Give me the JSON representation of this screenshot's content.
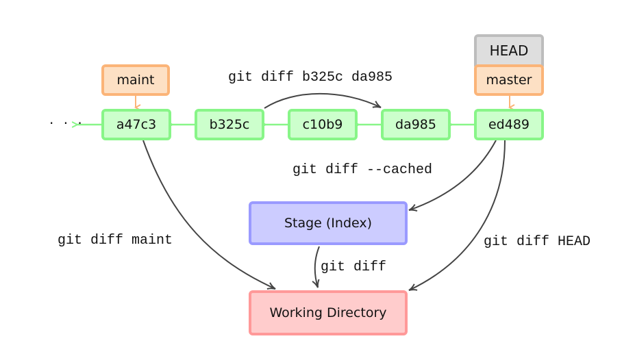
{
  "colors": {
    "commit_fill": "#ccffcc",
    "commit_border": "#88f588",
    "branch_fill": "#fde0c4",
    "branch_border": "#fbb478",
    "head_fill": "#dedede",
    "head_border": "#bdbdbd",
    "stage_fill": "#ccccff",
    "stage_border": "#9a9aff",
    "workdir_fill": "#ffcccc",
    "workdir_border": "#ff9999",
    "arrow_dark": "#444444"
  },
  "history": {
    "ellipsis": "· · ·",
    "commits": [
      "a47c3",
      "b325c",
      "c10b9",
      "da985",
      "ed489"
    ]
  },
  "refs": {
    "head": "HEAD",
    "master": "master",
    "maint": "maint"
  },
  "areas": {
    "stage": "Stage (Index)",
    "working_directory": "Working Directory"
  },
  "commands": {
    "commits": "git diff b325c da985",
    "cached": "git diff --cached",
    "maint": "git diff maint",
    "head": "git diff HEAD",
    "plain": "git diff"
  }
}
